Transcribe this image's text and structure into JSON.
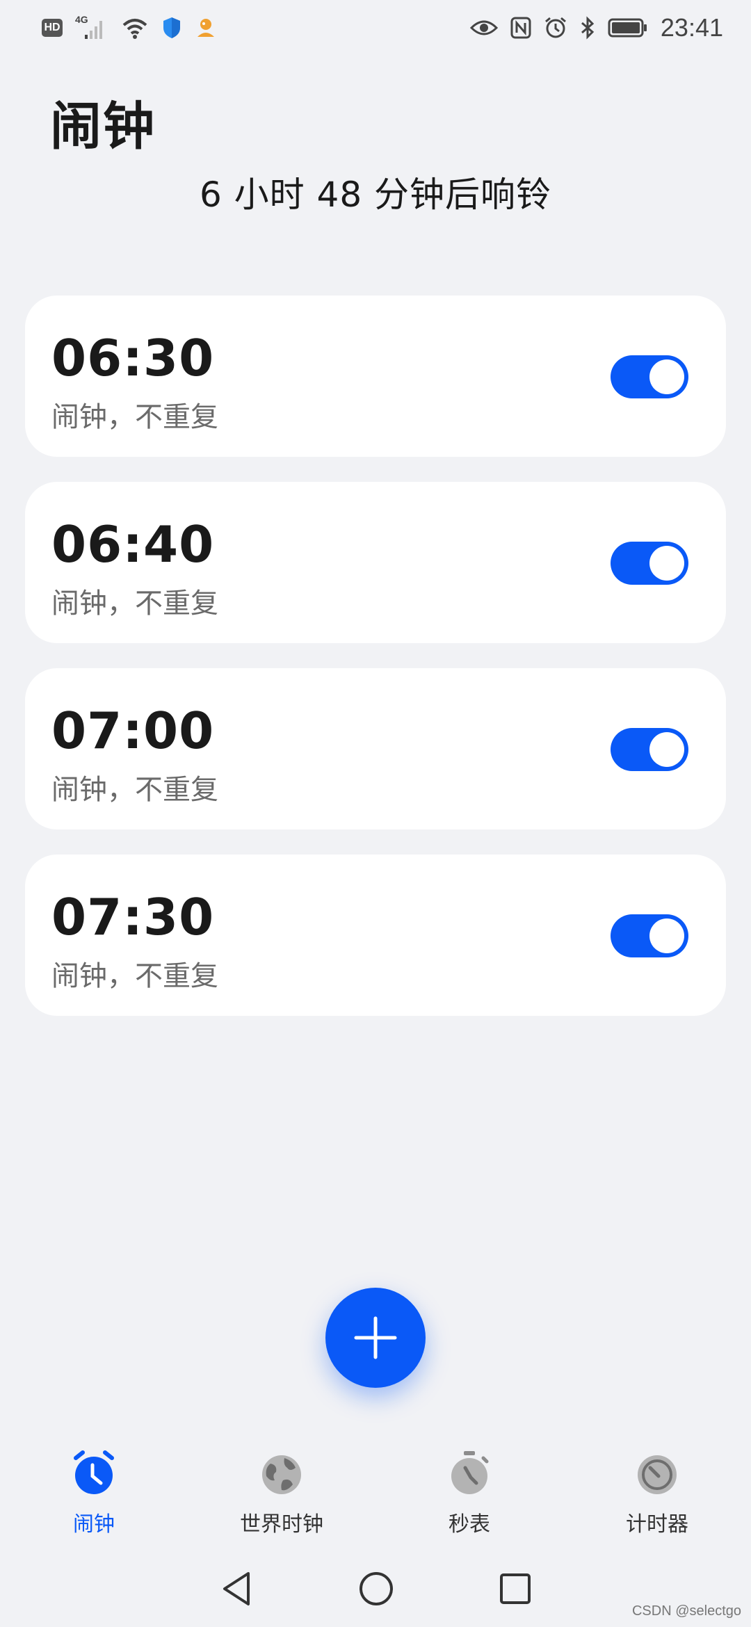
{
  "status_bar": {
    "hd": "HD",
    "network": "4G",
    "time": "23:41"
  },
  "title": "闹钟",
  "next_alarm_text": "6 小时 48 分钟后响铃",
  "alarms": [
    {
      "time": "06:30",
      "desc": "闹钟，不重复",
      "enabled": true
    },
    {
      "time": "06:40",
      "desc": "闹钟，不重复",
      "enabled": true
    },
    {
      "time": "07:00",
      "desc": "闹钟，不重复",
      "enabled": true
    },
    {
      "time": "07:30",
      "desc": "闹钟，不重复",
      "enabled": true
    }
  ],
  "bottom_nav": [
    {
      "label": "闹钟",
      "icon": "alarm-clock-icon",
      "active": true
    },
    {
      "label": "世界时钟",
      "icon": "globe-icon",
      "active": false
    },
    {
      "label": "秒表",
      "icon": "stopwatch-icon",
      "active": false
    },
    {
      "label": "计时器",
      "icon": "timer-icon",
      "active": false
    }
  ],
  "watermark": "CSDN @selectgo",
  "colors": {
    "accent": "#0a59f7",
    "background": "#f1f2f5",
    "card": "#ffffff",
    "inactive_icon": "#b3b3b3"
  }
}
